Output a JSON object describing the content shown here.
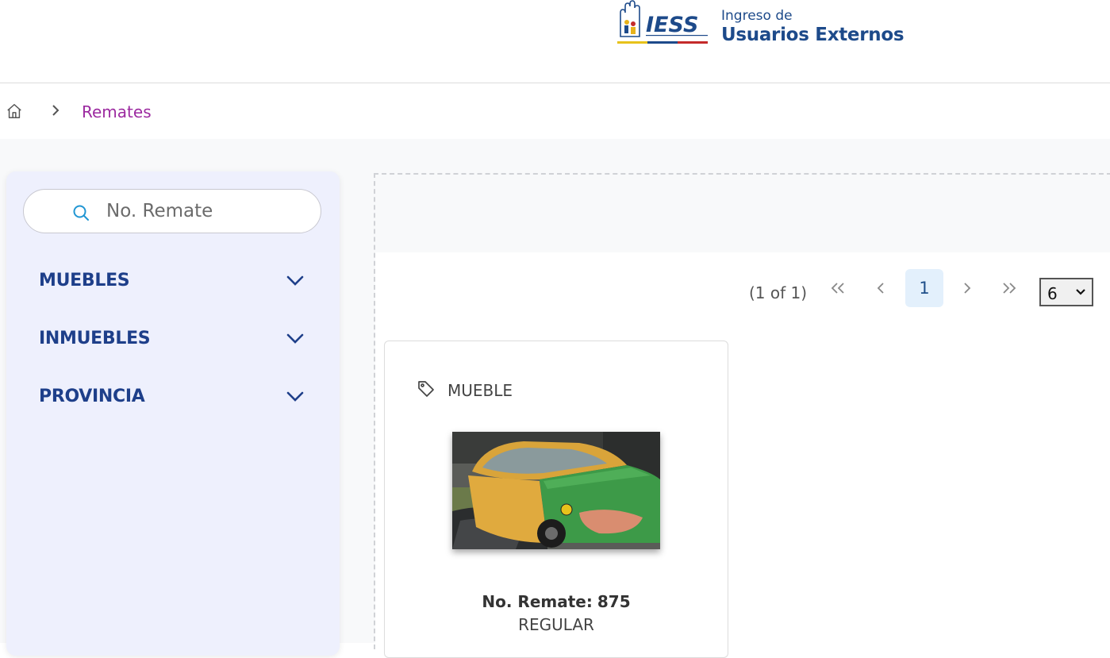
{
  "header": {
    "logo_brand": "IESS",
    "logo_subtitle": "Ingreso de",
    "logo_title": "Usuarios Externos"
  },
  "breadcrumb": {
    "home_icon": "home-icon",
    "separator_icon": "chevron-right-icon",
    "current": "Remates"
  },
  "sidebar": {
    "search": {
      "placeholder": "No. Remate",
      "value": "",
      "icon": "search-icon"
    },
    "filters": [
      {
        "label": "MUEBLES",
        "icon": "chevron-down-icon"
      },
      {
        "label": "INMUEBLES",
        "icon": "chevron-down-icon"
      },
      {
        "label": "PROVINCIA",
        "icon": "chevron-down-icon"
      }
    ]
  },
  "paginator": {
    "report": "(1 of 1)",
    "current_page": "1",
    "rows_per_page": "6",
    "icons": [
      "first-page-icon",
      "prev-page-icon",
      "next-page-icon",
      "last-page-icon"
    ]
  },
  "cards": [
    {
      "category": "MUEBLE",
      "category_icon": "tag-icon",
      "remate_label": "No. Remate:",
      "remate_number": "875",
      "state": "REGULAR"
    }
  ],
  "colors": {
    "brand_blue": "#1e3f8a",
    "breadcrumb_active": "#9c2aa0",
    "sidebar_bg": "#eef0fd",
    "page_active_bg": "#e3f0fc"
  }
}
